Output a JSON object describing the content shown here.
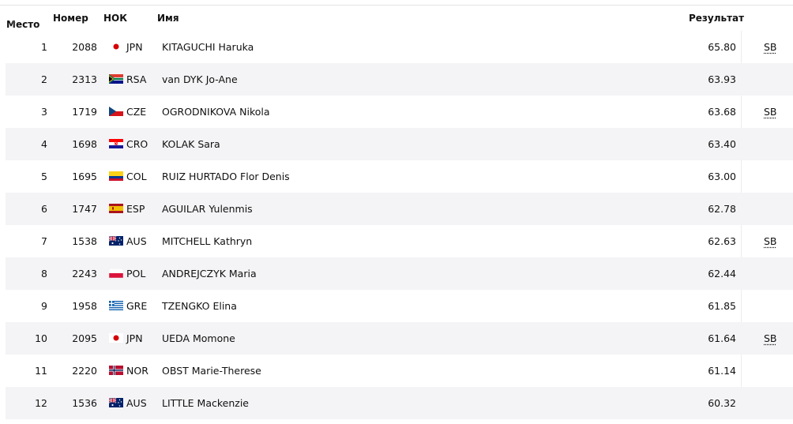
{
  "header": {
    "rank": "Место",
    "sort_indicator": "↑",
    "bib": "Номер",
    "noc": "НОК",
    "name": "Имя",
    "result": "Результат"
  },
  "rows": [
    {
      "rank": "1",
      "bib": "2088",
      "noc": "JPN",
      "name": "KITAGUCHI Haruka",
      "result": "65.80",
      "note": "SB"
    },
    {
      "rank": "2",
      "bib": "2313",
      "noc": "RSA",
      "name": "van DYK Jo-Ane",
      "result": "63.93",
      "note": ""
    },
    {
      "rank": "3",
      "bib": "1719",
      "noc": "CZE",
      "name": "OGRODNIKOVA Nikola",
      "result": "63.68",
      "note": "SB"
    },
    {
      "rank": "4",
      "bib": "1698",
      "noc": "CRO",
      "name": "KOLAK Sara",
      "result": "63.40",
      "note": ""
    },
    {
      "rank": "5",
      "bib": "1695",
      "noc": "COL",
      "name": "RUIZ HURTADO Flor Denis",
      "result": "63.00",
      "note": ""
    },
    {
      "rank": "6",
      "bib": "1747",
      "noc": "ESP",
      "name": "AGUILAR Yulenmis",
      "result": "62.78",
      "note": ""
    },
    {
      "rank": "7",
      "bib": "1538",
      "noc": "AUS",
      "name": "MITCHELL Kathryn",
      "result": "62.63",
      "note": "SB"
    },
    {
      "rank": "8",
      "bib": "2243",
      "noc": "POL",
      "name": "ANDREJCZYK Maria",
      "result": "62.44",
      "note": ""
    },
    {
      "rank": "9",
      "bib": "1958",
      "noc": "GRE",
      "name": "TZENGKO Elina",
      "result": "61.85",
      "note": ""
    },
    {
      "rank": "10",
      "bib": "2095",
      "noc": "JPN",
      "name": "UEDA Momone",
      "result": "61.64",
      "note": "SB"
    },
    {
      "rank": "11",
      "bib": "2220",
      "noc": "NOR",
      "name": "OBST Marie-Therese",
      "result": "61.14",
      "note": ""
    },
    {
      "rank": "12",
      "bib": "1536",
      "noc": "AUS",
      "name": "LITTLE Mackenzie",
      "result": "60.32",
      "note": ""
    }
  ]
}
